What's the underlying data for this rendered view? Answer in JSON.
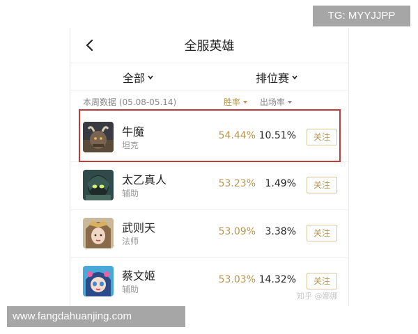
{
  "header": {
    "title": "全服英雄"
  },
  "filters": {
    "all": "全部",
    "rank": "排位赛"
  },
  "stats_header": {
    "week_label": "本周数据 (05.08-05.14)",
    "win_rate": "胜率",
    "pick_rate": "出场率"
  },
  "heroes": [
    {
      "name": "牛魔",
      "role": "坦克",
      "win_rate": "54.44%",
      "pick_rate": "10.51%",
      "follow": "关注"
    },
    {
      "name": "太乙真人",
      "role": "辅助",
      "win_rate": "53.23%",
      "pick_rate": "1.49%",
      "follow": "关注"
    },
    {
      "name": "武则天",
      "role": "法师",
      "win_rate": "53.09%",
      "pick_rate": "3.38%",
      "follow": "关注"
    },
    {
      "name": "蔡文姬",
      "role": "辅助",
      "win_rate": "53.03%",
      "pick_rate": "14.32%",
      "follow": "关注"
    }
  ],
  "watermarks": {
    "top_right": "TG: MYYJJPP",
    "bottom_left": "www.fangdahuanjing.com",
    "zhihu": "知乎 @娜娜"
  },
  "colors": {
    "accent": "#b89650",
    "highlight": "#c0393b"
  }
}
